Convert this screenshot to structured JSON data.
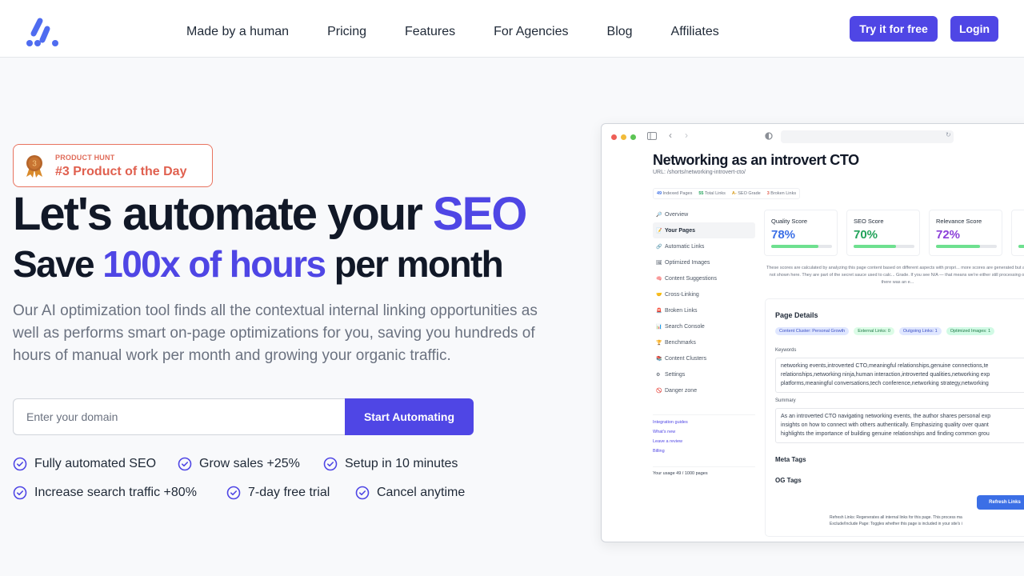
{
  "nav": {
    "links": [
      "Made by a human",
      "Pricing",
      "Features",
      "For Agencies",
      "Blog",
      "Affiliates"
    ],
    "try_button": "Try it for free",
    "login_button": "Login"
  },
  "badge": {
    "label": "PRODUCT HUNT",
    "title": "#3 Product of the Day",
    "rank": "3"
  },
  "hero": {
    "line1_prefix": "Let's automate your ",
    "line1_accent": "SEO",
    "line2_prefix": "Save ",
    "line2_accent": "100x of hours",
    "line2_suffix": " per month",
    "description": "Our AI optimization tool finds all the contextual internal linking opportunities as well as performs smart on-page optimizations for you, saving you hundreds of hours of manual work per month and growing your organic traffic."
  },
  "signup": {
    "placeholder": "Enter your domain",
    "button": "Start Automating"
  },
  "features": [
    "Fully automated SEO",
    "Grow sales +25%",
    "Setup in 10 minutes",
    "Increase search traffic +80%",
    "7-day free trial",
    "Cancel anytime"
  ],
  "colors": {
    "accent": "#4f46e5",
    "badge": "#e0604f"
  },
  "mockup": {
    "title": "Networking as an introvert CTO",
    "url": "URL: /shorts/networking-introvert-cto/",
    "stats": [
      {
        "value": "49",
        "label": "Indexed Pages",
        "color": "#3b6fe6"
      },
      {
        "value": "55",
        "label": "Total Links",
        "color": "#22a35a"
      },
      {
        "value": "A-",
        "label": "SEO Grade",
        "color": "#d89b1a"
      },
      {
        "value": "3",
        "label": "Broken Links",
        "color": "#e0604f"
      }
    ],
    "sidebar": [
      {
        "icon": "🔎",
        "label": "Overview"
      },
      {
        "icon": "📝",
        "label": "Your Pages",
        "active": true
      },
      {
        "icon": "🔗",
        "label": "Automatic Links"
      },
      {
        "icon": "🖼",
        "label": "Optimized Images"
      },
      {
        "icon": "🧠",
        "label": "Content Suggestions"
      },
      {
        "icon": "🤝",
        "label": "Cross-Linking"
      },
      {
        "icon": "🚨",
        "label": "Broken Links"
      },
      {
        "icon": "📊",
        "label": "Search Console"
      },
      {
        "icon": "🏆",
        "label": "Benchmarks"
      },
      {
        "icon": "📚",
        "label": "Content Clusters"
      },
      {
        "icon": "⚙",
        "label": "Settings"
      },
      {
        "icon": "🚫",
        "label": "Danger zone"
      }
    ],
    "links": [
      "Integration guides",
      "What's new",
      "Leave a review",
      "Billing"
    ],
    "usage": "Your usage 49 / 1000 pages",
    "scores": [
      {
        "label": "Quality Score",
        "value": "78%",
        "progress": 0.78,
        "color": "#3b6fe6"
      },
      {
        "label": "SEO Score",
        "value": "70%",
        "progress": 0.7,
        "color": "#22a35a"
      },
      {
        "label": "Relevance Score",
        "value": "72%",
        "progress": 0.72,
        "color": "#8b3fd9"
      },
      {
        "label": "",
        "value": "",
        "progress": 0.5,
        "color": "#e8742c"
      }
    ],
    "note": "These scores are calculated by analyzing this page content based on different aspects with propri... more scores are generated but are not shown here. They are part of the secret sauce used to calc... Grade. If you see N/A — that means we're either still processing or there was an e...",
    "details_title": "Page Details",
    "tags": [
      {
        "label": "Content Cluster: Personal Growth",
        "bg": "#e0e7ff",
        "fg": "#3b4fc4"
      },
      {
        "label": "External Links: 0",
        "bg": "#dcfce7",
        "fg": "#1f7a46"
      },
      {
        "label": "Outgoing Links: 1",
        "bg": "#e0e7ff",
        "fg": "#3b4fc4"
      },
      {
        "label": "Optimized Images: 1",
        "bg": "#d1fae5",
        "fg": "#1f7a46"
      }
    ],
    "keywords_label": "Keywords",
    "keywords": [
      "networking events,introverted CTO,meaningful relationships,genuine connections,te",
      "relationships,networking ninja,human interaction,introverted qualities,networking exp",
      "platforms,meaningful conversations,tech conference,networking strategy,networking"
    ],
    "summary_label": "Summary",
    "summary": [
      "As an introverted CTO navigating networking events, the author shares personal exp",
      "insights on how to connect with others authentically. Emphasizing quality over quant",
      "highlights the importance of building genuine relationships and finding common grou"
    ],
    "meta_tags": "Meta Tags",
    "og_tags": "OG Tags",
    "refresh_button": "Refresh Links",
    "refresh_note": "Refresh Links: Regenerates all internal links for this page. This process ma",
    "exclude_note": "Exclude/Include Page: Toggles whether this page is included in your site's i"
  }
}
